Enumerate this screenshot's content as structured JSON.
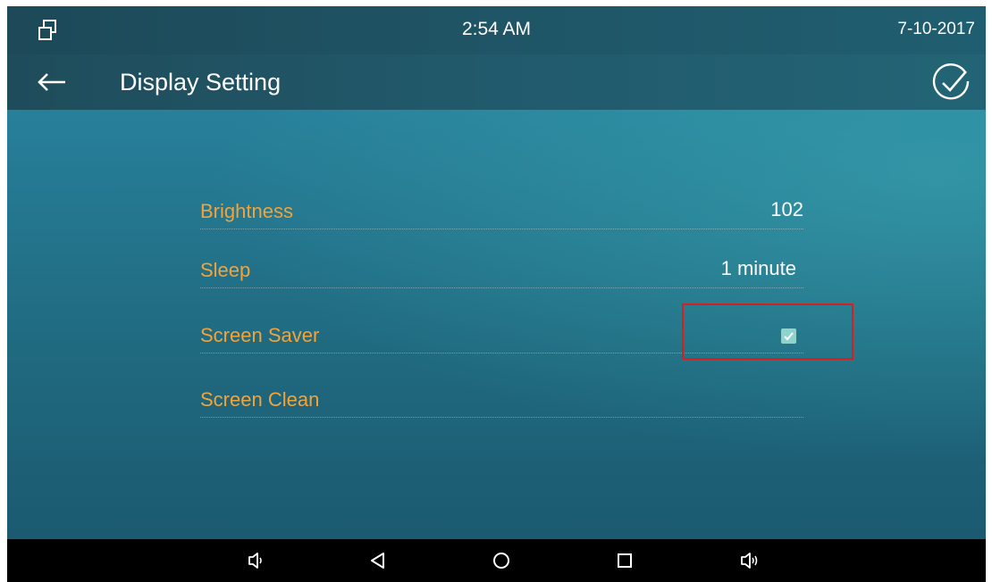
{
  "status_bar": {
    "time": "2:54 AM",
    "date": "7-10-2017",
    "icon": "multi-window-icon"
  },
  "header": {
    "title": "Display Setting",
    "back_icon": "back-arrow-icon",
    "confirm_icon": "check-circle-icon"
  },
  "settings": [
    {
      "label": "Brightness",
      "value": "102"
    },
    {
      "label": "Sleep",
      "value": "1 minute"
    },
    {
      "label": "Screen Saver",
      "value": "",
      "checked": true
    },
    {
      "label": "Screen Clean",
      "value": ""
    }
  ],
  "nav_bar": {
    "buttons": [
      "volume-down-icon",
      "back-icon",
      "home-icon",
      "recents-icon",
      "volume-up-icon"
    ]
  },
  "colors": {
    "label": "#f2a33a",
    "highlight": "#d62020",
    "checkbox": "#8fd3cf"
  }
}
